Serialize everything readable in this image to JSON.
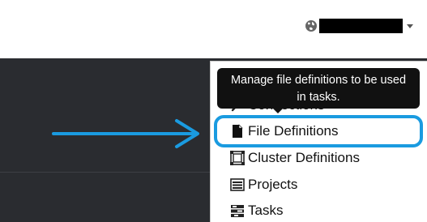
{
  "header": {
    "user_menu": {
      "globe_icon": "globe-icon",
      "caret_icon": "caret-down-icon"
    }
  },
  "dropdown": {
    "partial_top_label": "ettings",
    "items": [
      {
        "label": "Connections",
        "icon": "plug-icon"
      },
      {
        "label": "File Definitions",
        "icon": "file-icon",
        "highlighted": true
      },
      {
        "label": "Cluster Definitions",
        "icon": "cluster-icon"
      },
      {
        "label": "Projects",
        "icon": "projects-icon"
      },
      {
        "label": "Tasks",
        "icon": "tasks-icon"
      }
    ]
  },
  "tooltip": {
    "line1": "Manage file definitions to be used",
    "line2": "in tasks."
  },
  "colors": {
    "accent": "#1a9be0",
    "dark_panel": "#2a2c30",
    "tooltip_bg": "#111111"
  }
}
